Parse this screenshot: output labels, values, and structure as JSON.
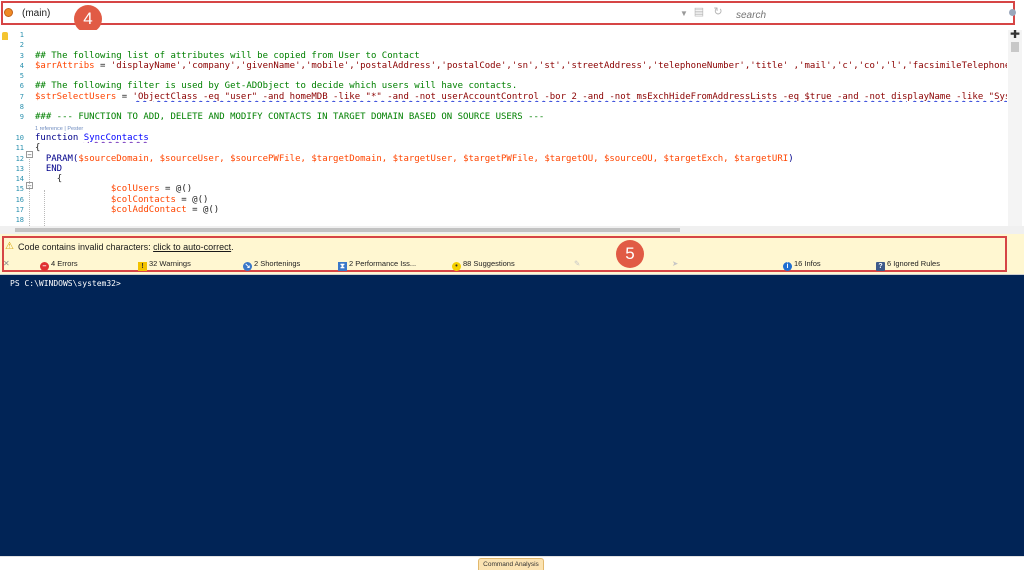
{
  "navbar": {
    "scope": "(main)",
    "search_placeholder": "search",
    "icons": [
      "powershell-scope-icon",
      "dropdown-arrow-icon",
      "save-icon",
      "refresh-icon",
      "search-icon"
    ]
  },
  "callouts": {
    "nav": "4",
    "analysis": "5"
  },
  "editor": {
    "line_numbers": [
      "1",
      "2",
      "3",
      "4",
      "5",
      "6",
      "7",
      "8",
      "9",
      "10",
      "11",
      "12",
      "13",
      "14",
      "15",
      "16",
      "17",
      "18"
    ],
    "lens": {
      "references": "1 reference",
      "separator": "|",
      "pester": "Pester"
    },
    "lines": {
      "l3": "## The following list of attributes will be copied from User to Contact",
      "l4_var": "$arrAttribs",
      "l4_rest": " = ",
      "l4_str": "'displayName','company','givenName','mobile','postalAddress','postalCode','sn','st','streetAddress','telephoneNumber','title' ,'mail','c','co','l','facsimileTelephoneNumber'",
      "l6": "## The following filter is used by Get-ADObject to decide which users will have contacts.",
      "l7_var": "$strSelectUsers",
      "l7_rest": " = ",
      "l7_str": "'ObjectClass -eq \"user\" -and homeMDB -like \"*\" -and -not userAccountControl -bor 2 -and -not msExchHideFromAddressLists -eq $true -and -not displayName -like \"SystemMailbox*\"'",
      "l9": "### --- FUNCTION TO ADD, DELETE AND MODIFY CONTACTS IN TARGET DOMAIN BASED ON SOURCE USERS ---",
      "l11_kw": "function",
      "l11_name": "SyncContacts",
      "l12": "{",
      "l13_kw": "PARAM(",
      "l13_vars": "$sourceDomain, $sourceUser, $sourcePWFile, $targetDomain, $targetUser, $targetPWFile, $targetOU, $sourceOU, $targetExch, $targetURI",
      "l13_end": ")",
      "l14": "END",
      "l15": "{",
      "l16_var": "$colUsers",
      "l16_rest": " = @()",
      "l17_var": "$colContacts",
      "l17_rest": " = @()",
      "l18_var": "$colAddContact",
      "l18_rest": " = @()"
    }
  },
  "analysis": {
    "message": "Code contains invalid characters:",
    "link": "click to auto-correct",
    "message_end": ".",
    "stats": [
      {
        "key": "errors",
        "label": "4 Errors",
        "color": "#e03131"
      },
      {
        "key": "warnings",
        "label": "32 Warnings",
        "color": "#f2c200"
      },
      {
        "key": "shortenings",
        "label": "2 Shortenings",
        "color": "#3a78c9"
      },
      {
        "key": "performance",
        "label": "2 Performance Iss...",
        "color": "#3a78c9"
      },
      {
        "key": "suggestions",
        "label": "88 Suggestions",
        "color": "#f5d000"
      },
      {
        "key": "infos",
        "label": "16 Infos",
        "color": "#1f6fd1"
      },
      {
        "key": "ignored",
        "label": "6 Ignored Rules",
        "color": "#3d5a8a"
      }
    ]
  },
  "console": {
    "prompt": "PS C:\\WINDOWS\\system32>"
  },
  "bottom": {
    "tab_label": "Command Analysis"
  },
  "colors": {
    "console_bg": "#012456",
    "analysis_bg": "#fff7d1",
    "callout": "#e15b45"
  }
}
